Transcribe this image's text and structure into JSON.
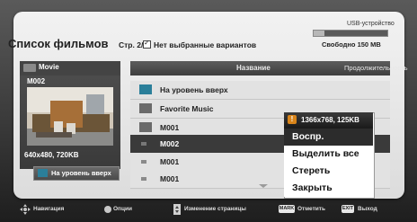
{
  "header": {
    "title": "Список фильмов",
    "page_info": "Стр. 2/3",
    "no_selected_label": "Нет выбранные вариантов",
    "device_label": "USB-устройство",
    "free_space": "Свободно 150 MB",
    "device_used_fraction": 0.15
  },
  "left_panel": {
    "section_label": "Movie",
    "current_name": "M002",
    "resolution_size": "640x480, 720KB",
    "up_button_label": "На уровень вверх"
  },
  "list": {
    "column_name": "Название",
    "column_duration": "Продолжительность",
    "rows": [
      {
        "label": "На уровень вверх",
        "icon": "up-folder-icon"
      },
      {
        "label": "Favorite Music",
        "icon": "folder-icon"
      },
      {
        "label": "M001",
        "icon": "folder-icon"
      },
      {
        "label": "M002",
        "icon": "movie-file-icon"
      },
      {
        "label": "M001",
        "icon": "movie-file-icon"
      },
      {
        "label": "M001",
        "icon": "movie-file-icon"
      }
    ]
  },
  "popup": {
    "info": "1366x768, 125KB",
    "items": [
      "Воспр.",
      "Выделить все",
      "Стереть",
      "Закрыть"
    ]
  },
  "footer": {
    "navigation": "Навигация",
    "options": "Опции",
    "page_change": "Изменение страницы",
    "mark_key": "MARK",
    "mark_label": "Отметить",
    "exit_key": "EXIT",
    "exit_label": "Выход"
  },
  "colors": {
    "accent_up": "#2b7f9a",
    "selected_row": "#3a3a3a",
    "warning": "#d8841a"
  }
}
